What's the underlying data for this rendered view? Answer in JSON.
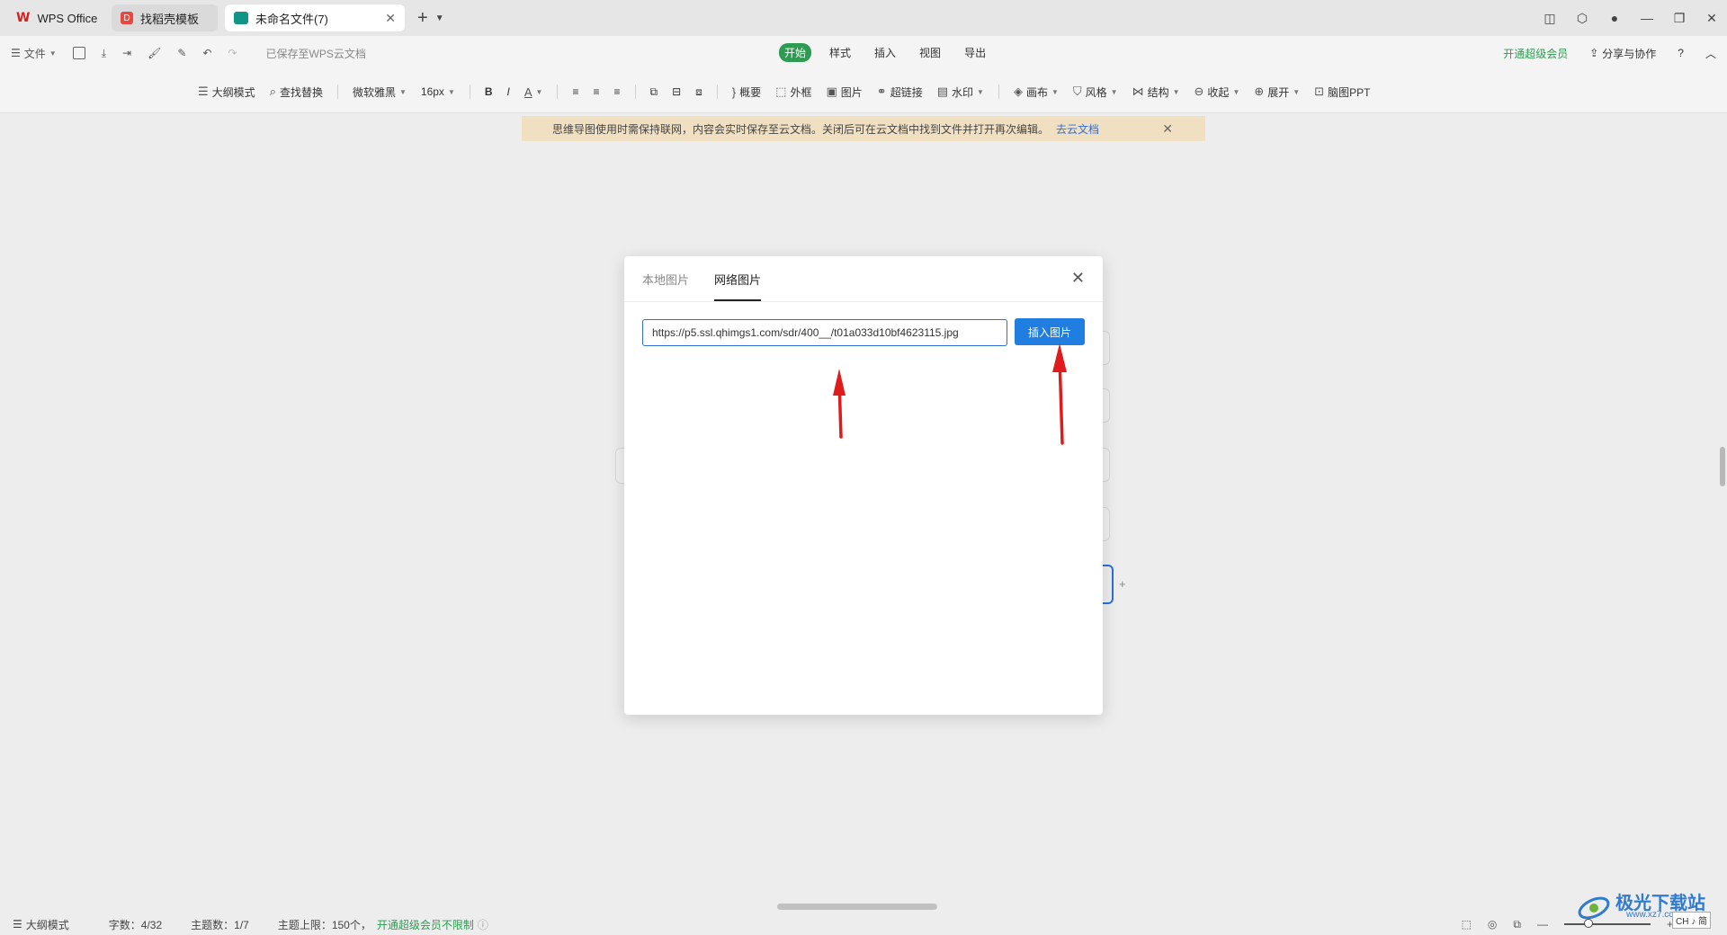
{
  "tabs": [
    {
      "label": "WPS Office",
      "icon": "wps-logo-icon"
    },
    {
      "label": "找稻壳模板",
      "icon": "docer-logo-icon"
    },
    {
      "label": "未命名文件(7)",
      "icon": "mindmap-logo-icon"
    }
  ],
  "menubar": {
    "file": "文件",
    "saved_status": "已保存至WPS云文档",
    "tabs": [
      "开始",
      "样式",
      "插入",
      "视图",
      "导出"
    ],
    "active_tab": "开始",
    "vip": "开通超级会员",
    "share": "分享与协作",
    "help": "?"
  },
  "toolbar": {
    "outline_mode": "大纲模式",
    "find_replace": "查找替换",
    "font": "微软雅黑",
    "size": "16px",
    "bold": "B",
    "italic": "I",
    "color": "A",
    "summary": "概要",
    "frame": "外框",
    "image": "图片",
    "link": "超链接",
    "watermark": "水印",
    "canvas": "画布",
    "style": "风格",
    "structure": "结构",
    "collapse": "收起",
    "expand": "展开",
    "to_ppt": "脑图PPT"
  },
  "notice": {
    "text": "思维导图使用时需保持联网，内容会实时保存至云文档。关闭后可在云文档中找到文件并打开再次编辑。",
    "link": "去云文档"
  },
  "modal": {
    "tabs": [
      "本地图片",
      "网络图片"
    ],
    "active_tab": "网络图片",
    "url_value": "https://p5.ssl.qhimgs1.com/sdr/400__/t01a033d10bf4623115.jpg",
    "insert_button": "插入图片"
  },
  "statusbar": {
    "outline_mode": "大纲模式",
    "word_count": "字数：4/32",
    "topic_count": "主题数：1/7",
    "topic_limit": "主题上限：150个，",
    "vip_unlimited": "开通超级会员不限制"
  },
  "watermark": {
    "brand": "极光下载站",
    "site": "www.xz7.com",
    "ime": "CH ♪ 简"
  },
  "colors": {
    "accent_green": "#2e9b52",
    "primary_blue": "#1f7ee0",
    "notice_bg": "#f1dfc2",
    "arrow_red": "#e01b1b"
  }
}
